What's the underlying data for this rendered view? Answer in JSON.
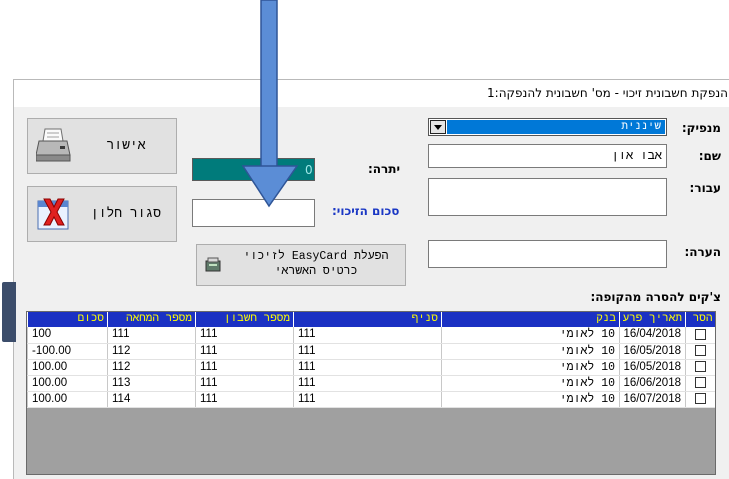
{
  "window": {
    "title": "הנפקת חשבונית זיכוי  - מס' חשבונית להנפקה:1"
  },
  "form": {
    "issuer_label": "מנפיק:",
    "issuer_value": "שיננית",
    "name_label": "שם:",
    "name_value": "אבו און",
    "for_label": "עבור:",
    "for_value": "",
    "note_label": "הערה:",
    "note_value": "",
    "balance_label": "יתרה:",
    "balance_value": "0",
    "credit_amount_label": "סכום הזיכוי:",
    "credit_amount_value": ""
  },
  "buttons": {
    "confirm": "אישור",
    "close_window": "סגור חלון",
    "easycard_line1": "הפעלת EasyCard לזיכוי",
    "easycard_line2": "כרטיס האשראי"
  },
  "grid": {
    "caption": "צ'קים להסרה מהקופה:",
    "columns": [
      "הסר",
      "תאריך פרעון",
      "בנק",
      "סניף",
      "מספר חשבון",
      "מספר המחאה",
      "סכום"
    ],
    "rows": [
      {
        "remove": false,
        "date": "16/04/2018",
        "bank": "10 לאומי",
        "branch": "111",
        "account": "111",
        "check": "111",
        "amount": "100"
      },
      {
        "remove": false,
        "date": "16/05/2018",
        "bank": "10 לאומי",
        "branch": "111",
        "account": "111",
        "check": "112",
        "amount": "100.00-"
      },
      {
        "remove": false,
        "date": "16/05/2018",
        "bank": "10 לאומי",
        "branch": "111",
        "account": "111",
        "check": "112",
        "amount": "100.00"
      },
      {
        "remove": false,
        "date": "16/06/2018",
        "bank": "10 לאומי",
        "branch": "111",
        "account": "111",
        "check": "113",
        "amount": "100.00"
      },
      {
        "remove": false,
        "date": "16/07/2018",
        "bank": "10 לאומי",
        "branch": "111",
        "account": "111",
        "check": "114",
        "amount": "100.00"
      }
    ]
  },
  "colors": {
    "grid_header_bg": "#1b31c3",
    "grid_header_text": "#ffff00",
    "balance_bg": "#007b7b",
    "annotation_arrow": "#5b8dd6"
  },
  "icons": {
    "confirm": "printer-icon",
    "close": "red-x-icon",
    "easycard": "card-reader-icon",
    "annotation": "down-arrow-icon"
  }
}
